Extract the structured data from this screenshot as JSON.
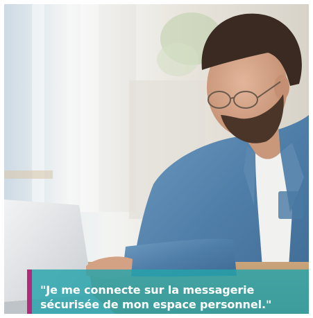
{
  "photo": {
    "icon": "man-working-on-laptop-photo"
  },
  "caption": {
    "line1": "\"Je me connecte sur la messagerie",
    "line2": "sécurisée de mon espace personnel.\"",
    "accent_color": "#b22a7a",
    "box_color": "#26a3ab"
  }
}
